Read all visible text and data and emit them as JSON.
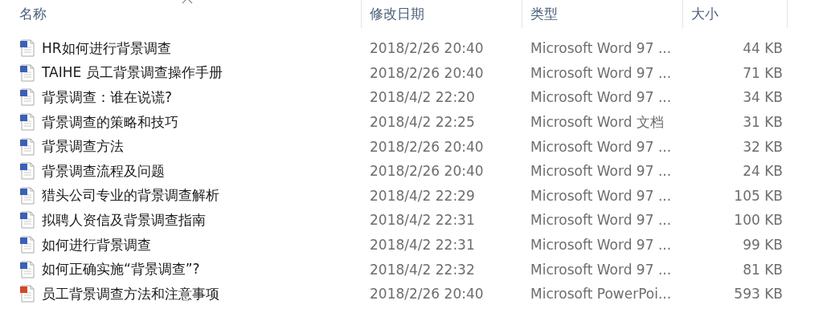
{
  "table": {
    "columns": [
      {
        "label": "名称",
        "sorted": true
      },
      {
        "label": "修改日期",
        "sorted": false
      },
      {
        "label": "类型",
        "sorted": false
      },
      {
        "label": "大小",
        "sorted": false
      }
    ],
    "rows": [
      {
        "kind": "word",
        "name": "HR如何进行背景调查",
        "modified": "2018/2/26 20:40",
        "type": "Microsoft Word 97 ...",
        "size": "44 KB"
      },
      {
        "kind": "word",
        "name": "TAIHE 员工背景调查操作手册",
        "modified": "2018/2/26 20:40",
        "type": "Microsoft Word 97 ...",
        "size": "71 KB"
      },
      {
        "kind": "word",
        "name": "背景调查：谁在说谎?",
        "modified": "2018/4/2 22:20",
        "type": "Microsoft Word 97 ...",
        "size": "34 KB"
      },
      {
        "kind": "word",
        "name": "背景调查的策略和技巧",
        "modified": "2018/4/2 22:25",
        "type": "Microsoft Word 文档",
        "size": "31 KB"
      },
      {
        "kind": "word",
        "name": "背景调查方法",
        "modified": "2018/2/26 20:40",
        "type": "Microsoft Word 97 ...",
        "size": "32 KB"
      },
      {
        "kind": "word",
        "name": "背景调查流程及问题",
        "modified": "2018/2/26 20:40",
        "type": "Microsoft Word 97 ...",
        "size": "24 KB"
      },
      {
        "kind": "word",
        "name": "猎头公司专业的背景调查解析",
        "modified": "2018/4/2 22:29",
        "type": "Microsoft Word 97 ...",
        "size": "105 KB"
      },
      {
        "kind": "word",
        "name": "拟聘人资信及背景调查指南",
        "modified": "2018/4/2 22:31",
        "type": "Microsoft Word 97 ...",
        "size": "100 KB"
      },
      {
        "kind": "word",
        "name": "如何进行背景调查",
        "modified": "2018/4/2 22:31",
        "type": "Microsoft Word 97 ...",
        "size": "99 KB"
      },
      {
        "kind": "word",
        "name": "如何正确实施“背景调查”?",
        "modified": "2018/4/2 22:32",
        "type": "Microsoft Word 97 ...",
        "size": "81 KB"
      },
      {
        "kind": "powerpoint",
        "name": "员工背景调查方法和注意事项",
        "modified": "2018/2/26 20:40",
        "type": "Microsoft PowerPoi...",
        "size": "593 KB"
      }
    ]
  }
}
